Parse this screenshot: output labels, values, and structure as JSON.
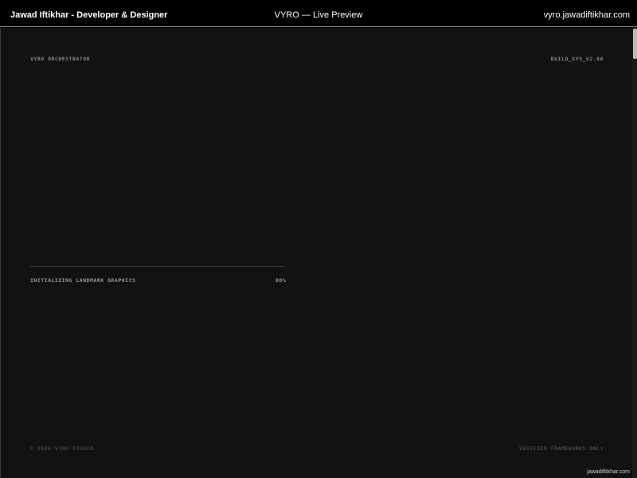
{
  "topbar": {
    "author": "Jawad Iftikhar - Developer & Designer",
    "title": "VYRO — Live Preview",
    "domain": "vyro.jawadiftikhar.com"
  },
  "preview": {
    "orchestrator_label": "VYRO ORCHESTRATOR",
    "build_label": "BUILD_SYS_V2.06",
    "status_text": "INITIALIZING LANDMARK GRAPHICS",
    "progress_text": "00%",
    "progress_value": 0,
    "copyright": "© 2026 VYRO STUDIO",
    "verified_text": "VERIFIED FRAMEWORKS ONLY"
  },
  "watermark": "jawadiftikhar.com",
  "colors": {
    "topbar_bg": "#000000",
    "page_bg": "#121113",
    "muted_text": "#8b8b8b",
    "dim_text": "#5e5e5e"
  }
}
